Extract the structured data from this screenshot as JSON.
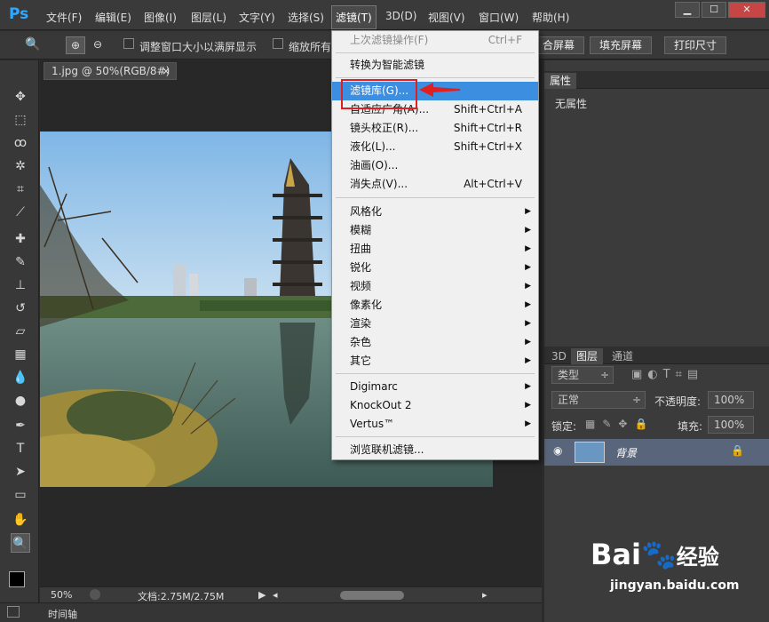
{
  "app": {
    "logo": "Ps"
  },
  "menubar": {
    "items": [
      "文件(F)",
      "编辑(E)",
      "图像(I)",
      "图层(L)",
      "文字(Y)",
      "选择(S)",
      "滤镜(T)",
      "3D(D)",
      "视图(V)",
      "窗口(W)",
      "帮助(H)"
    ]
  },
  "window_controls": {
    "minimize": "▁",
    "maximize": "☐",
    "close": "✕"
  },
  "options": {
    "resize_label": "调整窗口大小以满屏显示",
    "zoom_all_label": "缩放所有",
    "fit_btn": "合屏幕",
    "fill_btn": "填充屏幕",
    "print_btn": "打印尺寸"
  },
  "document": {
    "tab_title": "1.jpg @ 50%(RGB/8#)",
    "tab_close": "×"
  },
  "status": {
    "zoom": "50%",
    "doc_info": "文档:2.75M/2.75M",
    "play": "▶",
    "left": "◂",
    "right": "▸"
  },
  "timeline": {
    "label": "时间轴"
  },
  "properties": {
    "title": "属性",
    "empty": "无属性"
  },
  "layers": {
    "tabs": [
      "3D",
      "图层",
      "通道"
    ],
    "filter_type": "类型",
    "blend_mode": "正常",
    "opacity_label": "不透明度:",
    "opacity_value": "100%",
    "lock_label": "锁定:",
    "fill_label": "填充:",
    "fill_value": "100%",
    "layer_name": "背景",
    "dropdown_arrow": "÷"
  },
  "filter_menu": {
    "items": [
      {
        "label": "上次滤镜操作(F)",
        "shortcut": "Ctrl+F",
        "disabled": true
      },
      {
        "label": "转换为智能滤镜"
      },
      {
        "label": "滤镜库(G)...",
        "highlight": true
      },
      {
        "label": "自适应广角(A)...",
        "shortcut": "Shift+Ctrl+A"
      },
      {
        "label": "镜头校正(R)...",
        "shortcut": "Shift+Ctrl+R"
      },
      {
        "label": "液化(L)...",
        "shortcut": "Shift+Ctrl+X"
      },
      {
        "label": "油画(O)..."
      },
      {
        "label": "消失点(V)...",
        "shortcut": "Alt+Ctrl+V"
      },
      {
        "label": "风格化",
        "sub": true
      },
      {
        "label": "模糊",
        "sub": true
      },
      {
        "label": "扭曲",
        "sub": true
      },
      {
        "label": "锐化",
        "sub": true
      },
      {
        "label": "视频",
        "sub": true
      },
      {
        "label": "像素化",
        "sub": true
      },
      {
        "label": "渲染",
        "sub": true
      },
      {
        "label": "杂色",
        "sub": true
      },
      {
        "label": "其它",
        "sub": true
      },
      {
        "label": "Digimarc",
        "sub": true
      },
      {
        "label": "KnockOut 2",
        "sub": true
      },
      {
        "label": "Vertus™",
        "sub": true
      },
      {
        "label": "浏览联机滤镜..."
      }
    ]
  },
  "watermark": {
    "brand": "Bai",
    "brand2": "经验",
    "url": "jingyan.baidu.com"
  },
  "colors": {
    "accent": "#3c8ee0",
    "highlight_box": "#e02020",
    "ps_blue": "#31a8ff"
  }
}
